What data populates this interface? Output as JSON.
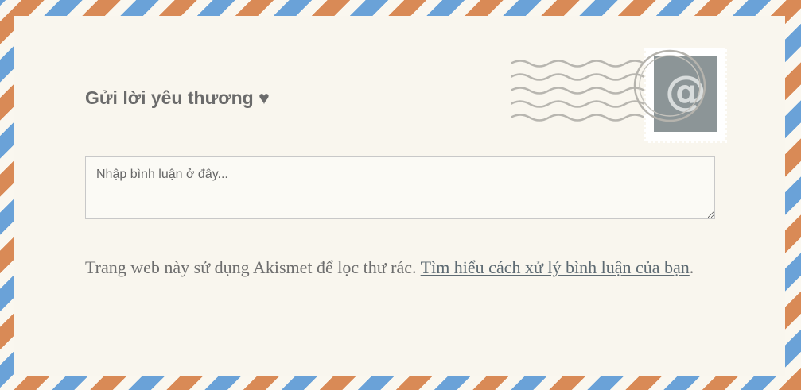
{
  "form": {
    "title": "Gửi lời yêu thương ♥",
    "comment_placeholder": "Nhập bình luận ở đây..."
  },
  "notice": {
    "text": "Trang web này sử dụng Akismet để lọc thư rác. ",
    "link_label": "Tìm hiểu cách xử lý bình luận của bạn",
    "suffix": "."
  },
  "icons": {
    "stamp": "at-sign-stamp-icon",
    "postmark": "postmark-waves-icon"
  },
  "colors": {
    "stripe_orange": "#d98a56",
    "stripe_blue": "#6aa2d8",
    "paper": "#f9f6ee",
    "stamp_gray": "#8c9597"
  }
}
